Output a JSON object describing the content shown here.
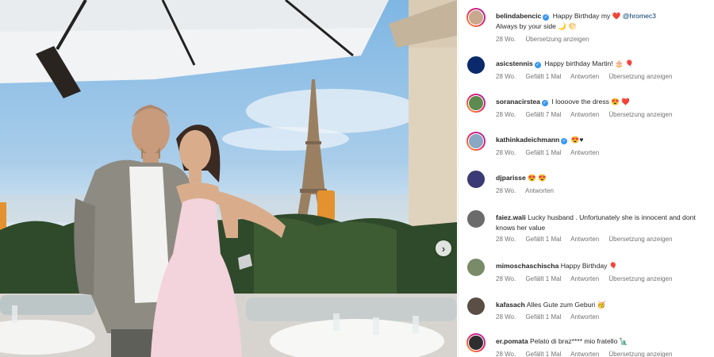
{
  "post": {
    "next_button_glyph": "›"
  },
  "labels": {
    "like": "Gefällt 1 Mal",
    "reply": "Antworten",
    "translate": "Übersetzung anzeigen"
  },
  "comments": [
    {
      "username": "belindabencic",
      "verified": true,
      "text_pre": "Happy Birthday my",
      "emoji_1": "❤️",
      "mention": "@hromec3",
      "line2": "Always by your side 🌙 🌕",
      "time": "28 Wo.",
      "likes": "",
      "reply": "",
      "translate": "Übersetzung anzeigen",
      "avatar_color": "#c9a98d"
    },
    {
      "username": "asicstennis",
      "verified": true,
      "text": "Happy birthday Martin! 🎂 🎈",
      "time": "28 Wo.",
      "likes": "Gefällt 1 Mal",
      "reply": "Antworten",
      "translate": "Übersetzung anzeigen",
      "avatar_color": "#0a2a6b"
    },
    {
      "username": "soranacirstea",
      "verified": true,
      "text": "I loooove the dress 😍 ❤️",
      "time": "28 Wo.",
      "likes": "Gefällt 7 Mal",
      "reply": "Antworten",
      "translate": "Übersetzung anzeigen",
      "avatar_color": "#5d8a4f"
    },
    {
      "username": "kathinkadeichmann",
      "verified": true,
      "text": "😍♥",
      "time": "28 Wo.",
      "likes": "Gefällt 1 Mal",
      "reply": "Antworten",
      "translate": "",
      "avatar_color": "#8aa7c4"
    },
    {
      "username": "djparisse",
      "verified": false,
      "text": "😍 😍",
      "time": "28 Wo.",
      "likes": "",
      "reply": "Antworten",
      "translate": "",
      "avatar_color": "#3b3a74"
    },
    {
      "username": "faiez.wali",
      "verified": false,
      "text": "Lucky husband . Unfortunately she is innocent and dont knows her value",
      "time": "28 Wo.",
      "likes": "Gefällt 1 Mal",
      "reply": "Antworten",
      "translate": "Übersetzung anzeigen",
      "avatar_color": "#6b6b6b"
    },
    {
      "username": "mimoschaschischa",
      "verified": false,
      "text": "Happy Birthday 🎈",
      "time": "28 Wo.",
      "likes": "Gefällt 1 Mal",
      "reply": "Antworten",
      "translate": "Übersetzung anzeigen",
      "avatar_color": "#7a8b6a"
    },
    {
      "username": "kafasach",
      "verified": false,
      "text": "Alles Gute zum Geburi 🥳",
      "time": "28 Wo.",
      "likes": "Gefällt 1 Mal",
      "reply": "Antworten",
      "translate": "",
      "avatar_color": "#5a4e45"
    },
    {
      "username": "er.pomata",
      "verified": false,
      "text": "Pelato di braz**** mio fratello 🗽",
      "time": "28 Wo.",
      "likes": "Gefällt 1 Mal",
      "reply": "Antworten",
      "translate": "Übersetzung anzeigen",
      "avatar_color": "#2e2e2e"
    }
  ]
}
